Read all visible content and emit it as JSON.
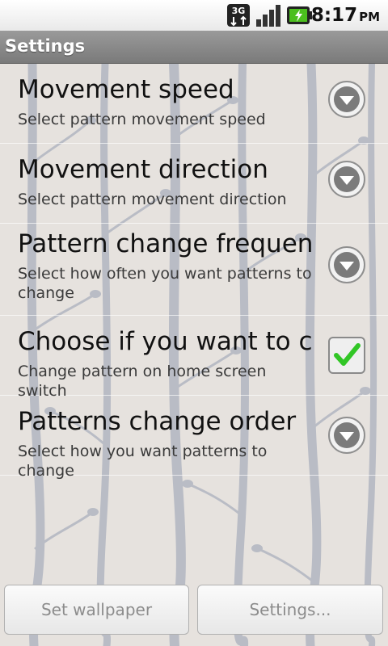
{
  "statusbar": {
    "time": "8:17",
    "ampm": "PM",
    "network_icon": "3g-icon",
    "signal_icon": "signal-icon",
    "battery_icon": "battery-charging-icon"
  },
  "titlebar": {
    "title": "Settings"
  },
  "preferences": [
    {
      "title": "Movement speed",
      "summary": "Select pattern movement speed",
      "widget": "dropdown-arrow-icon"
    },
    {
      "title": "Movement direction",
      "summary": "Select pattern movement direction",
      "widget": "dropdown-arrow-icon"
    },
    {
      "title": "Pattern change frequency",
      "summary": "Select how often you want patterns to change",
      "widget": "dropdown-arrow-icon"
    },
    {
      "title": "Choose if you want to ch",
      "summary": "Change pattern on home screen switch",
      "widget": "checkbox-checked-icon",
      "checked": true
    },
    {
      "title": "Patterns change order",
      "summary": "Select how you want patterns to change",
      "widget": "dropdown-arrow-icon"
    }
  ],
  "buttons": {
    "set_wallpaper": "Set wallpaper",
    "settings": "Settings..."
  },
  "colors": {
    "background": "#e6e2de",
    "pattern": "#b9bcc5",
    "titlebar": "#8a8a8a",
    "checkmark": "#31c626"
  }
}
